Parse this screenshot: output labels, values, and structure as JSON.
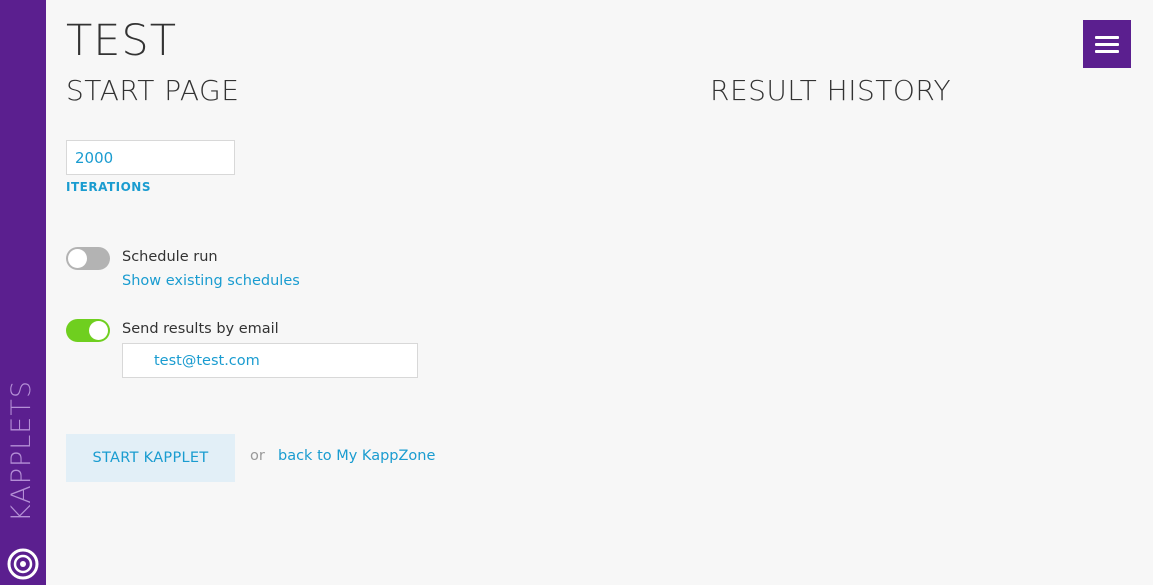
{
  "sidebar": {
    "label": "KAPPLETS",
    "logo_icon": "kapplets-logo-icon"
  },
  "header": {
    "title": "TEST",
    "menu_icon": "hamburger-menu-icon"
  },
  "start_page": {
    "title": "START PAGE",
    "iterations": {
      "value": "2000",
      "label": "ITERATIONS"
    },
    "schedule": {
      "label": "Schedule run",
      "enabled": false,
      "link": "Show existing schedules"
    },
    "email": {
      "label": "Send results by email",
      "enabled": true,
      "value": "test@test.com"
    },
    "actions": {
      "start_label": "START KAPPLET",
      "or_text": "or",
      "back_link": "back to My KappZone"
    }
  },
  "result_history": {
    "title": "RESULT HISTORY"
  },
  "colors": {
    "accent": "#5b1f8f",
    "link": "#1a9cd0",
    "toggle_on": "#6fcf1f",
    "toggle_off": "#b3b3b3"
  }
}
